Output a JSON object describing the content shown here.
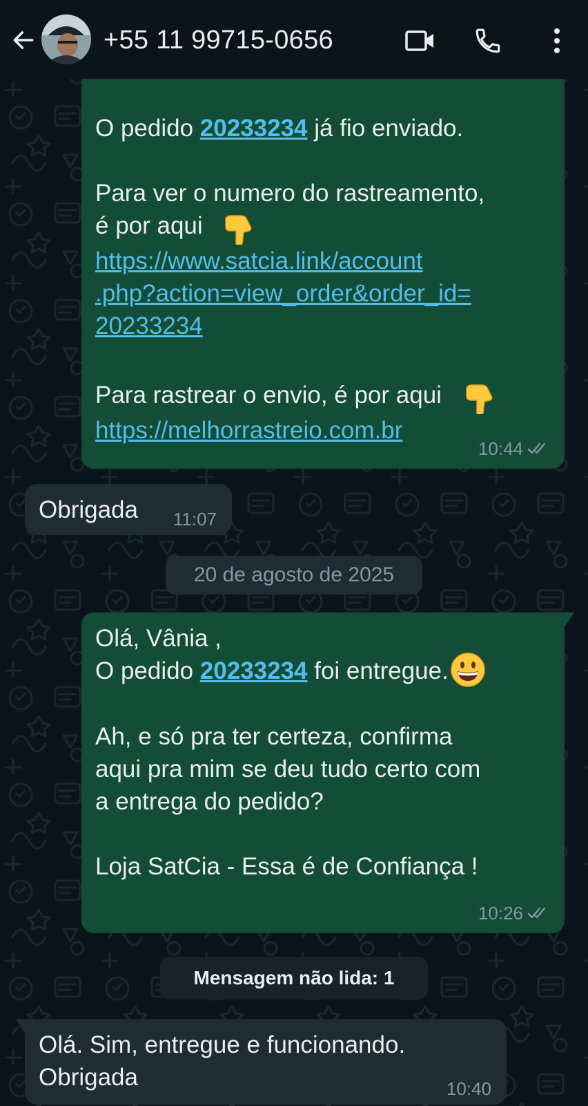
{
  "header": {
    "title": "+55 11 99715-0656",
    "icons": [
      "back-arrow-icon",
      "avatar",
      "video-call-icon",
      "phone-icon",
      "more-options-icon"
    ]
  },
  "messages": [
    {
      "direction": "outgoing",
      "line1_prefix": "O pedido ",
      "order_link": "20233234",
      "line1_suffix": " já fio enviado.",
      "tracking_intro_1": "Para ver o numero do rastreamento,",
      "tracking_intro_2": "é por aqui",
      "tracking_link_line1": "https://www.satcia.link/account",
      "tracking_link_line2": ".php?action=view_order&order_id=",
      "tracking_link_line3": "20233234",
      "track_intro": "Para rastrear o envio, é por aqui",
      "track_link": "https://melhorrastreio.com.br",
      "time": "10:44",
      "status": "read"
    },
    {
      "direction": "incoming",
      "text": "Obrigada",
      "time": "11:07"
    },
    {
      "direction": "outgoing",
      "greeting": "Olá, Vânia ,",
      "line_prefix": "O pedido ",
      "order_link": "20233234",
      "line_suffix": " foi entregue.",
      "confirm_1": "Ah, e só pra ter certeza, confirma",
      "confirm_2": "aqui pra mim se deu tudo certo com",
      "confirm_3": "a entrega do pedido?",
      "signature": "Loja SatCia - Essa é de Confiança !",
      "time": "10:26",
      "status": "read"
    },
    {
      "direction": "incoming",
      "line1": "Olá. Sim, entregue e funcionando.",
      "line2": "Obrigada",
      "time": "10:40"
    }
  ],
  "date_separator": "20 de agosto de 2025",
  "unread_banner": "Mensagem não lida: 1",
  "colors": {
    "background": "#0b141a",
    "outgoing_bubble": "#144d37",
    "incoming_bubble": "#202c33",
    "link": "#53bdeb",
    "meta_text": "#8696a0",
    "primary_text": "#e9edef"
  }
}
